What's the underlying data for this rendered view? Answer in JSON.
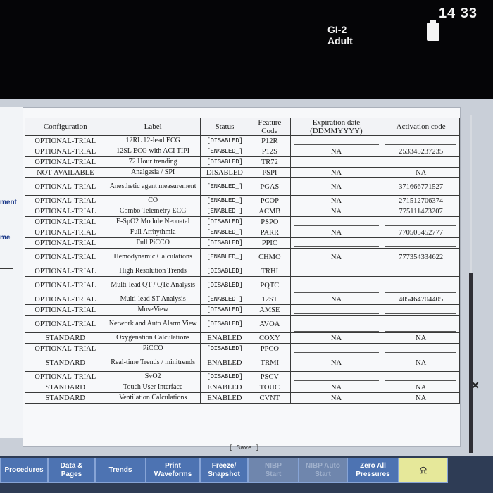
{
  "status_bar": {
    "bed": "GI-2",
    "patient_category": "Adult",
    "time": "14 33",
    "battery_icon": "battery-icon"
  },
  "left_panel": {
    "items": [
      {
        "label": "ment"
      },
      {
        "label": "me"
      }
    ]
  },
  "table": {
    "headers": {
      "configuration": "Configuration",
      "label": "Label",
      "status": "Status",
      "feature_code": "Feature Code",
      "expiration": "Expiration date (DDMMYYYY)",
      "activation": "Activation code"
    },
    "rows": [
      {
        "config": "OPTIONAL-TRIAL",
        "label": "12RL 12-lead ECG",
        "status": "[DISABLED]",
        "code": "P12R",
        "expiration": "",
        "activation": ""
      },
      {
        "config": "OPTIONAL-TRIAL",
        "label": "12SL ECG with ACI TIPI",
        "status": "[ENABLED_]",
        "code": "P12S",
        "expiration": "NA",
        "activation": "253345237235"
      },
      {
        "config": "OPTIONAL-TRIAL",
        "label": "72 Hour trending",
        "status": "[DISABLED]",
        "code": "TR72",
        "expiration": "",
        "activation": ""
      },
      {
        "config": "NOT-AVAILABLE",
        "label": "Analgesia / SPI",
        "status": "DISABLED",
        "code": "PSPI",
        "expiration": "NA",
        "activation": "NA"
      },
      {
        "config": "OPTIONAL-TRIAL",
        "label": "Anesthetic agent measurement",
        "status": "[ENABLED_]",
        "code": "PGAS",
        "expiration": "NA",
        "activation": "371666771527"
      },
      {
        "config": "OPTIONAL-TRIAL",
        "label": "CO",
        "status": "[ENABLED_]",
        "code": "PCOP",
        "expiration": "NA",
        "activation": "271512706374"
      },
      {
        "config": "OPTIONAL-TRIAL",
        "label": "Combo Telemetry ECG",
        "status": "[ENABLED_]",
        "code": "ACMB",
        "expiration": "NA",
        "activation": "775111473207"
      },
      {
        "config": "OPTIONAL-TRIAL",
        "label": "E-SpO2 Module Neonatal",
        "status": "[DISABLED]",
        "code": "PSPO",
        "expiration": "",
        "activation": ""
      },
      {
        "config": "OPTIONAL-TRIAL",
        "label": "Full Arrhythmia",
        "status": "[ENABLED_]",
        "code": "PARR",
        "expiration": "NA",
        "activation": "770505452777"
      },
      {
        "config": "OPTIONAL-TRIAL",
        "label": "Full PiCCO",
        "status": "[DISABLED]",
        "code": "PPIC",
        "expiration": "",
        "activation": ""
      },
      {
        "config": "OPTIONAL-TRIAL",
        "label": "Hemodynamic Calculations",
        "status": "[ENABLED_]",
        "code": "CHMO",
        "expiration": "NA",
        "activation": "777354334622"
      },
      {
        "config": "OPTIONAL-TRIAL",
        "label": "High Resolution Trends",
        "status": "[DISABLED]",
        "code": "TRHI",
        "expiration": "",
        "activation": ""
      },
      {
        "config": "OPTIONAL-TRIAL",
        "label": "Multi-lead QT / QTc Analysis",
        "status": "[DISABLED]",
        "code": "PQTC",
        "expiration": "",
        "activation": ""
      },
      {
        "config": "OPTIONAL-TRIAL",
        "label": "Multi-lead ST Analysis",
        "status": "[ENABLED_]",
        "code": "12ST",
        "expiration": "NA",
        "activation": "405464704405"
      },
      {
        "config": "OPTIONAL-TRIAL",
        "label": "MuseView",
        "status": "[DISABLED]",
        "code": "AMSE",
        "expiration": "",
        "activation": ""
      },
      {
        "config": "OPTIONAL-TRIAL",
        "label": "Network and Auto Alarm View",
        "status": "[DISABLED]",
        "code": "AVOA",
        "expiration": "",
        "activation": ""
      },
      {
        "config": "STANDARD",
        "label": "Oxygenation Calculations",
        "status": "ENABLED",
        "code": "COXY",
        "expiration": "NA",
        "activation": "NA"
      },
      {
        "config": "OPTIONAL-TRIAL",
        "label": "PiCCO",
        "status": "[DISABLED]",
        "code": "PPCO",
        "expiration": "",
        "activation": ""
      },
      {
        "config": "STANDARD",
        "label": "Real-time Trends / minitrends",
        "status": "ENABLED",
        "code": "TRMI",
        "expiration": "NA",
        "activation": "NA"
      },
      {
        "config": "OPTIONAL-TRIAL",
        "label": "SvO2",
        "status": "[DISABLED]",
        "code": "PSCV",
        "expiration": "",
        "activation": ""
      },
      {
        "config": "STANDARD",
        "label": "Touch User Interface",
        "status": "ENABLED",
        "code": "TOUC",
        "expiration": "NA",
        "activation": "NA"
      },
      {
        "config": "STANDARD",
        "label": "Ventilation Calculations",
        "status": "ENABLED",
        "code": "CVNT",
        "expiration": "NA",
        "activation": "NA"
      }
    ]
  },
  "save_label": "[ Save ]",
  "softkeys": [
    {
      "label": "Procedures",
      "enabled": true
    },
    {
      "label": "Data &\nPages",
      "enabled": true
    },
    {
      "label": "Trends",
      "enabled": true
    },
    {
      "label": "Print\nWaveforms",
      "enabled": true
    },
    {
      "label": "Freeze/\nSnapshot",
      "enabled": true
    },
    {
      "label": "NIBP\nStart",
      "enabled": false
    },
    {
      "label": "NIBP Auto\nStart",
      "enabled": false
    },
    {
      "label": "Zero All\nPressures",
      "enabled": true
    },
    {
      "label": "⍾",
      "enabled": true,
      "icon": "alarm-bell-icon"
    }
  ],
  "colors": {
    "softkey_bg": "#4d73b2",
    "softkey_disabled": "#6f86ad",
    "alarm_key": "#e6e89a",
    "screen_bg": "#c9cfd8"
  }
}
